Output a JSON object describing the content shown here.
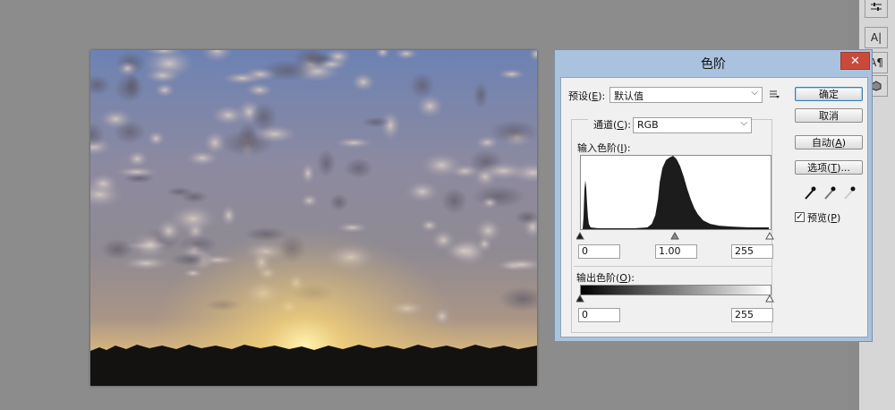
{
  "dialog": {
    "title": "色阶",
    "close_glyph": "✕",
    "preset_label": "预设(",
    "preset_key": "E",
    "preset_tail": "):",
    "preset_value": "默认值",
    "channel_label": "通道(",
    "channel_key": "C",
    "channel_tail": "):",
    "channel_value": "RGB",
    "input_levels_label": "输入色阶(",
    "input_levels_key": "I",
    "input_levels_tail": "):",
    "input_black": "0",
    "input_gamma": "1.00",
    "input_white": "255",
    "output_levels_label": "输出色阶(",
    "output_levels_key": "O",
    "output_levels_tail": "):",
    "output_black": "0",
    "output_white": "255",
    "buttons": {
      "ok": "确定",
      "cancel": "取消",
      "auto_label": "自动(",
      "auto_key": "A",
      "auto_tail": ")",
      "options_label": "选项(",
      "options_key": "T",
      "options_tail": ")..."
    },
    "preview_label": "预览(",
    "preview_key": "P",
    "preview_tail": ")",
    "preview_checked": true
  },
  "right_strip": {
    "text_tool_glyph": "A|",
    "char_tool_glyph": "A¶"
  },
  "icons": [
    "close-icon",
    "preset-menu-icon",
    "dropdown-arrow-icon",
    "eyedropper-black-icon",
    "eyedropper-gray-icon",
    "eyedropper-white-icon",
    "check-icon"
  ]
}
